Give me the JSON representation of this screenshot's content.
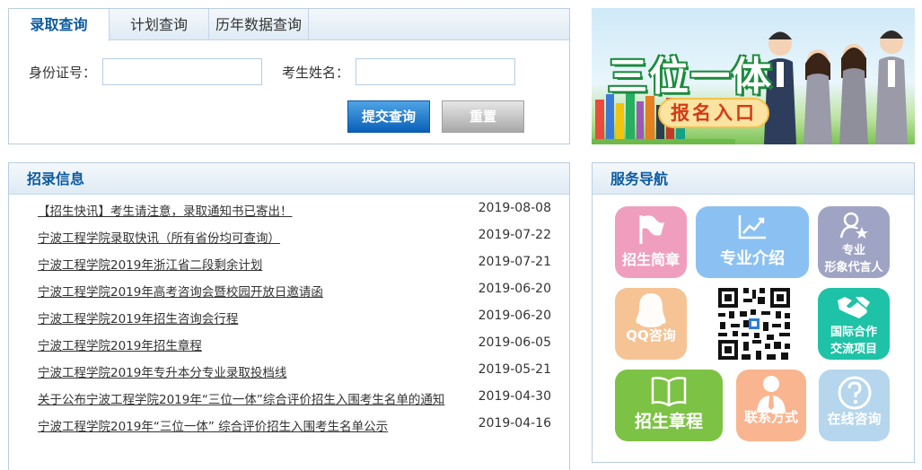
{
  "query": {
    "tabs": [
      "录取查询",
      "计划查询",
      "历年数据查询"
    ],
    "id_label": "身份证号：",
    "name_label": "考生姓名：",
    "id_value": "",
    "name_value": "",
    "submit_label": "提交查询",
    "reset_label": "重置"
  },
  "banner": {
    "title": "三位一体",
    "subtitle": "报名入口"
  },
  "news": {
    "title": "招录信息",
    "items": [
      {
        "text": "【招生快讯】考生请注意，录取通知书已寄出！",
        "date": "2019-08-08"
      },
      {
        "text": "宁波工程学院录取快讯（所有省份均可查询）",
        "date": "2019-07-22"
      },
      {
        "text": "宁波工程学院2019年浙江省二段剩余计划",
        "date": "2019-07-21"
      },
      {
        "text": "宁波工程学院2019年高考咨询会暨校园开放日邀请函",
        "date": "2019-06-20"
      },
      {
        "text": "宁波工程学院2019年招生咨询会行程",
        "date": "2019-06-20"
      },
      {
        "text": "宁波工程学院2019年招生章程",
        "date": "2019-06-05"
      },
      {
        "text": "宁波工程学院2019年专升本分专业录取投档线",
        "date": "2019-05-21"
      },
      {
        "text": "关于公布宁波工程学院2019年“三位一体”综合评价招生入围考生名单的通知",
        "date": "2019-04-30"
      },
      {
        "text": "宁波工程学院2019年“三位一体” 综合评价招生入围考生名单公示",
        "date": "2019-04-16"
      }
    ]
  },
  "service": {
    "title": "服务导航",
    "tiles": {
      "brochure": "招生简章",
      "majors": "专业介绍",
      "ambassador_1": "专业",
      "ambassador_2": "形象代言人",
      "qq": "QQ咨询",
      "intl_1": "国际合作",
      "intl_2": "交流项目",
      "charter": "招生章程",
      "contact": "联系方式",
      "online": "在线咨询"
    },
    "colors": {
      "pink": "#ef9fbd",
      "blue": "#8bc1f2",
      "slate": "#9fa4c4",
      "peach": "#f5c394",
      "teal": "#1ec2a6",
      "green": "#7cc244",
      "salmon": "#f9b58f",
      "light_blue": "#b5d6ec"
    }
  }
}
